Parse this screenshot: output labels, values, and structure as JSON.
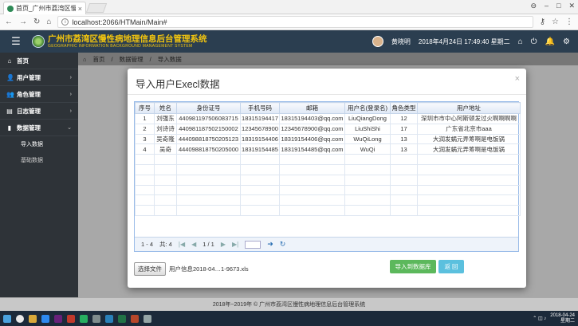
{
  "browser": {
    "tab_title": "首页_广州市荔湾区慢性…",
    "url": "localhost:2066/HTMain/Main#"
  },
  "header": {
    "title": "广州市荔湾区慢性病地理信息后台管理系统",
    "subtitle": "GEOGRAPHIC INFORMATION BACKGROUND MANAGEMENT SYSTEM",
    "user": "黄晓明",
    "datetime": "2018年4月24日 17:49:40 星期二"
  },
  "sidebar": {
    "items": [
      {
        "label": "首页",
        "icon": "home-icon"
      },
      {
        "label": "用户管理",
        "icon": "user-icon"
      },
      {
        "label": "角色管理",
        "icon": "users-icon"
      },
      {
        "label": "日志管理",
        "icon": "log-icon"
      },
      {
        "label": "数据管理",
        "icon": "chart-icon"
      }
    ],
    "sub_items": [
      {
        "label": "导入数据"
      },
      {
        "label": "基础数据"
      }
    ]
  },
  "breadcrumb": {
    "home": "首页",
    "section": "数据管理",
    "page": "导入数据"
  },
  "modal": {
    "title": "导入用户Execl数据",
    "columns": [
      "序号",
      "姓名",
      "身份证号",
      "手机号码",
      "邮箱",
      "用户名(登录名)",
      "角色类型",
      "用户地址"
    ],
    "rows": [
      [
        "1",
        "刘强东",
        "440981197506083715",
        "18315194417",
        "18315194403@qq.com",
        "LiuQiangDong",
        "12",
        "深圳市市中心阿斯顿发过火啊啊啊啊"
      ],
      [
        "2",
        "刘诗诗",
        "440981187502150002",
        "12345678900",
        "12345678900@qq.com",
        "LiuShiShi",
        "17",
        "广东省北京市aaa"
      ],
      [
        "3",
        "吴奇隆",
        "444098818750205123",
        "18319154406",
        "18319154406@qq.com",
        "WuQiLong",
        "13",
        "大润发蜗元弄筹啊是电饭锅"
      ],
      [
        "4",
        "吴奇",
        "444098818750205000",
        "18319154485",
        "18319154485@qq.com",
        "WuQi",
        "13",
        "大润发蜗元弄筹啊是电饭锅"
      ]
    ],
    "pager": {
      "range": "1 - 4",
      "total": "共: 4",
      "page": "1 / 1"
    },
    "file_button": "选择文件",
    "file_name": "用户信息2018-04…1-9673.xls",
    "import_button": "导入到数据库",
    "back_button": "返 回"
  },
  "footer": {
    "text": "2018年~2019年 © 广州市荔湾区慢性病地理信息后台管理系统"
  },
  "taskbar": {
    "date_time": "2018-04-24",
    "weekday": "星期二"
  }
}
